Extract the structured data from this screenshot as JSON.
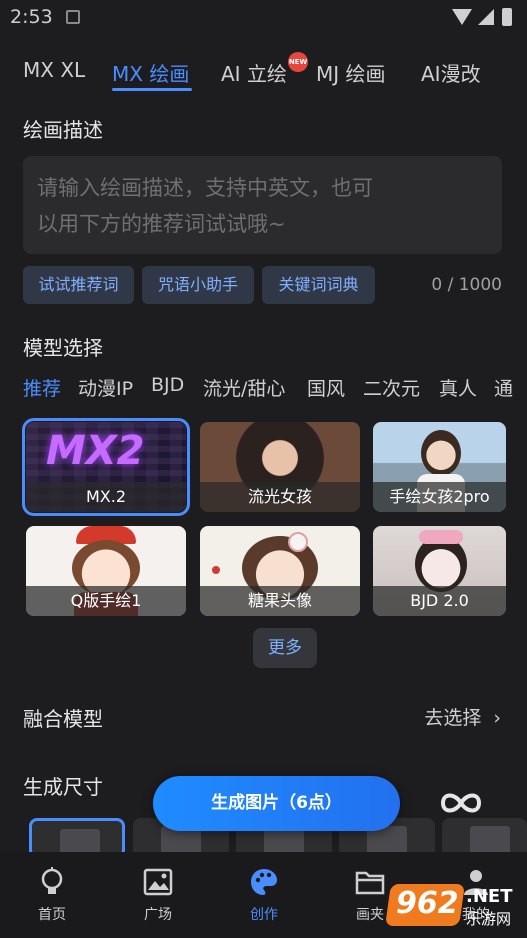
{
  "status_bar": {
    "time": "2:53"
  },
  "tabs": [
    {
      "label": "MX XL"
    },
    {
      "label": "MX 绘画"
    },
    {
      "label": "AI 立绘"
    },
    {
      "label": "MJ 绘画"
    },
    {
      "label": "AI漫改"
    }
  ],
  "new_badge": "NEW",
  "description": {
    "title": "绘画描述",
    "placeholder_line1": "请输入绘画描述，支持中英文，也可",
    "placeholder_line2": "以用下方的推荐词试试哦~",
    "counter": "0 / 1000",
    "chips": [
      "试试推荐词",
      "咒语小助手",
      "关键词词典"
    ]
  },
  "model": {
    "title": "模型选择",
    "categories": [
      "推荐",
      "动漫IP",
      "BJD",
      "流光/甜心",
      "国风",
      "二次元",
      "真人",
      "通"
    ],
    "cards": [
      {
        "caption": "MX.2",
        "art": "MX2"
      },
      {
        "caption": "流光女孩"
      },
      {
        "caption": "手绘女孩2pro"
      },
      {
        "caption": "Q版手绘1"
      },
      {
        "caption": "糖果头像"
      },
      {
        "caption": "BJD 2.0"
      }
    ],
    "more": "更多"
  },
  "fusion": {
    "title": "融合模型",
    "link": "去选择"
  },
  "size": {
    "title": "生成尺寸"
  },
  "generate_button": "生成图片（6点）",
  "bottom_nav": [
    {
      "label": "首页",
      "icon": "bulb-icon"
    },
    {
      "label": "广场",
      "icon": "image-icon"
    },
    {
      "label": "创作",
      "icon": "palette-icon"
    },
    {
      "label": "画夹",
      "icon": "folder-icon"
    },
    {
      "label": "我的",
      "icon": "user-icon"
    }
  ],
  "watermark": {
    "number": "962",
    "suffix": ".NET",
    "text": "乐游网"
  },
  "colors": {
    "accent": "#4a8dff",
    "background": "#1d1d1f",
    "button": "#1f8cff"
  }
}
